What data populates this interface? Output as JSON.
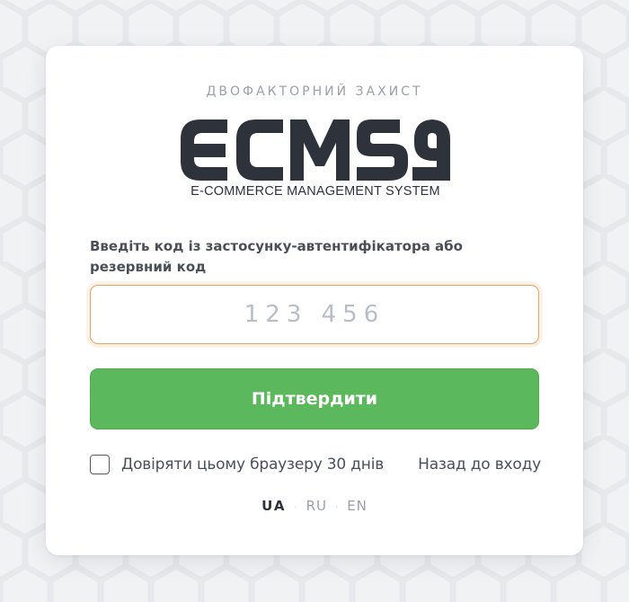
{
  "page": {
    "subtitle": "ДВОФАКТОРНИЙ ЗАХИСТ",
    "background_color": "#f1f2f4"
  },
  "logo": {
    "wordmark": "ECMS9",
    "tagline": "E-COMMERCE MANAGEMENT SYSTEM",
    "color": "#2d323b"
  },
  "form": {
    "code_label": "Введіть код із застосунку-автентифікатора або резервний код",
    "code_value": "",
    "code_placeholder": "123 456",
    "submit_label": "Підтвердити",
    "trust_label": "Довіряти цьому браузеру 30 днів",
    "trust_checked": false,
    "back_link": "Назад до входу"
  },
  "languages": {
    "items": [
      "UA",
      "RU",
      "EN"
    ],
    "active": "UA",
    "separator": "·"
  },
  "colors": {
    "accent_green": "#5cb85c",
    "input_focus_border": "#e8a35c",
    "text_dark": "#2d323b",
    "text_muted": "#9a9fa8"
  }
}
